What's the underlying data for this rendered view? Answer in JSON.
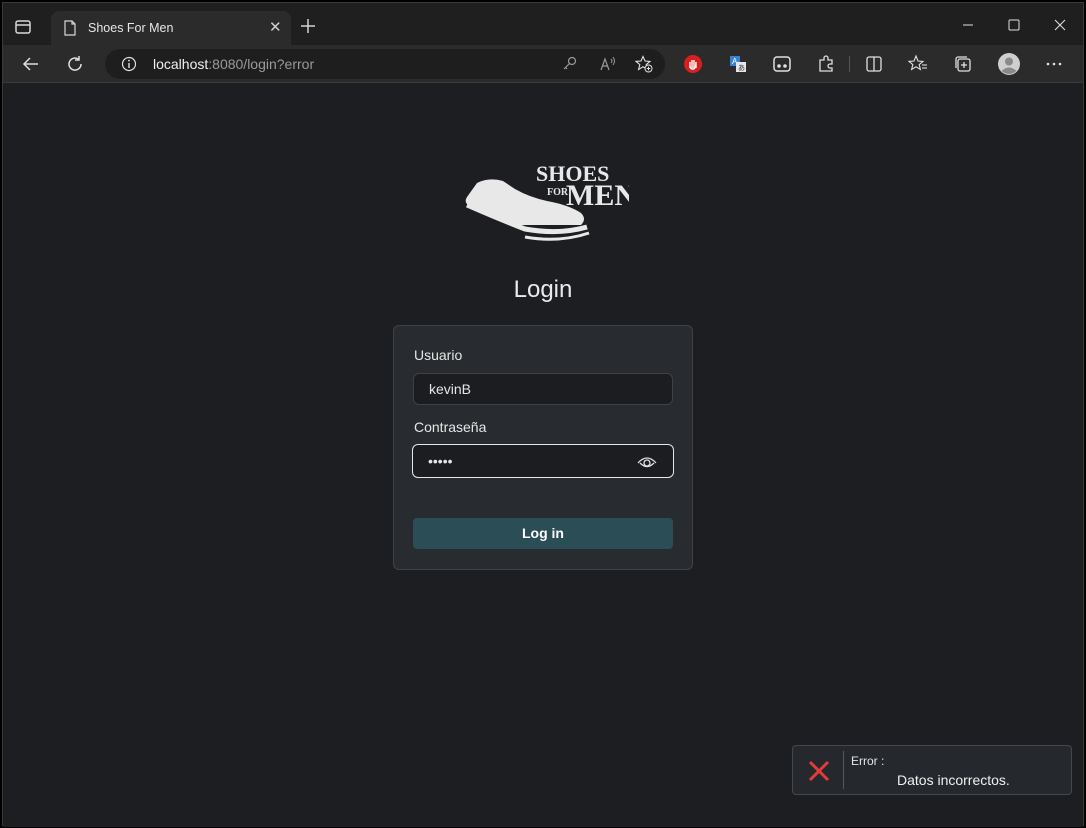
{
  "browser": {
    "tab_title": "Shoes For Men",
    "tab_close": "✕",
    "url_host": "localhost",
    "url_rest": ":8080/login?error",
    "icons": [
      "tab-actions-icon",
      "document-icon",
      "new-tab-icon",
      "minimize-icon",
      "maximize-icon",
      "close-icon",
      "back-icon",
      "refresh-icon",
      "info-icon",
      "key-icon",
      "read-aloud-icon",
      "add-favorite-icon",
      "adblock-icon",
      "translate-icon",
      "extension-face-icon",
      "extensions-icon",
      "split-screen-icon",
      "favorites-icon",
      "collections-icon",
      "profile-icon",
      "more-icon"
    ]
  },
  "page": {
    "logo_text": {
      "line1": "SHOES",
      "line2": "FOR",
      "line3": "MEN"
    },
    "title": "Login",
    "form": {
      "username_label": "Usuario",
      "username_value": "kevinB",
      "password_label": "Contraseña",
      "password_value": "•••••",
      "submit_label": "Log in"
    }
  },
  "toast": {
    "title": "Error :",
    "message": "Datos incorrectos.",
    "accent_color": "#e03c3c"
  },
  "colors": {
    "page_bg": "#1c1e22",
    "card_bg": "#282b30",
    "button_bg": "#2b4d55"
  }
}
